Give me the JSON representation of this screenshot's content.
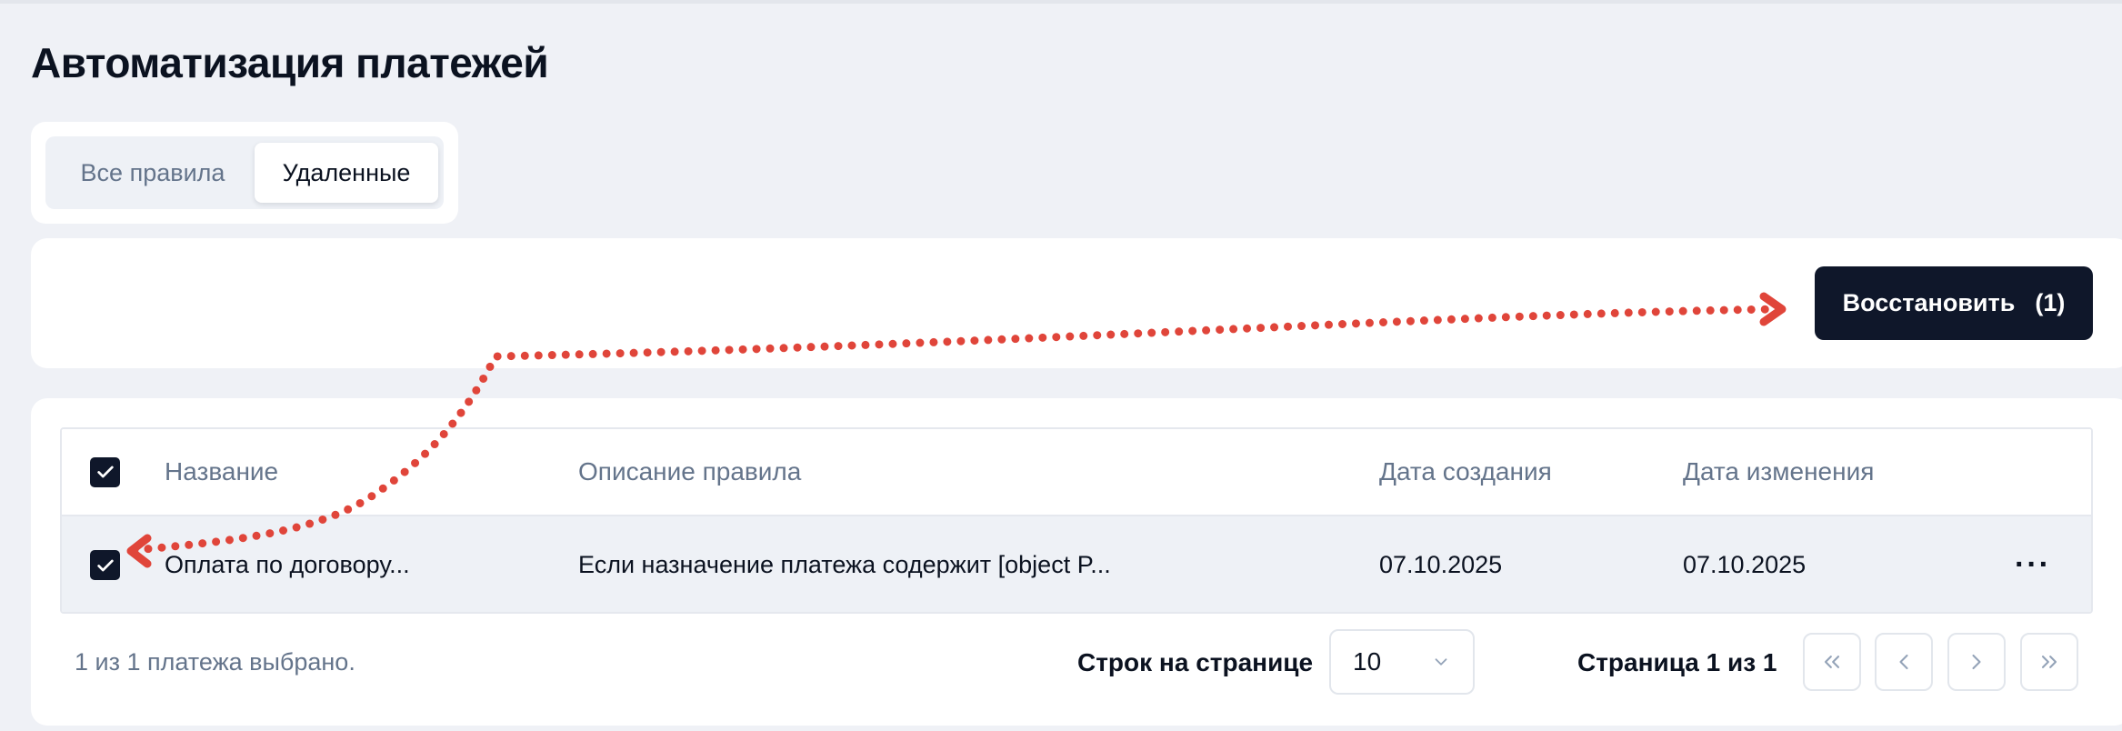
{
  "page": {
    "title": "Автоматизация платежей"
  },
  "tabs": [
    {
      "label": "Все правила",
      "active": false
    },
    {
      "label": "Удаленные",
      "active": true
    }
  ],
  "toolbar": {
    "restore_label": "Восстановить",
    "restore_count": "(1)"
  },
  "table": {
    "columns": [
      "Название",
      "Описание правила",
      "Дата создания",
      "Дата изменения"
    ],
    "rows": [
      {
        "selected": true,
        "name": "Оплата по договору...",
        "description": "Если назначение платежа содержит [object P...",
        "created": "07.10.2025",
        "changed": "07.10.2025",
        "more": "···"
      }
    ]
  },
  "footer": {
    "selection_text": "1 из 1 платежа выбрано.",
    "rows_per_page_label": "Строк на странице",
    "rows_per_page_value": "10",
    "page_info": "Страница 1 из 1"
  },
  "icons": {
    "checkbox": "check-icon",
    "select": "chevron-down-icon",
    "pagination": [
      "chevrons-left-icon",
      "chevron-left-icon",
      "chevron-right-icon",
      "chevrons-right-icon"
    ]
  },
  "colors": {
    "accent": "#0f172a",
    "annotation": "#e0453a",
    "background": "#eff1f6"
  }
}
